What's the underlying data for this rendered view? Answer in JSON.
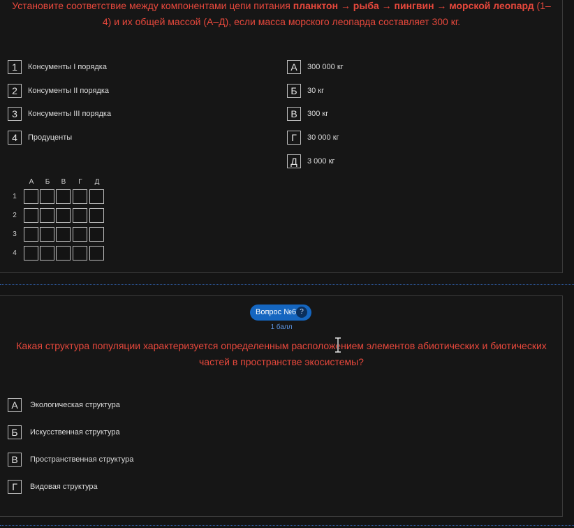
{
  "q5": {
    "title_parts": [
      {
        "t": "Установите соответствие между компонентами цепи питания ",
        "b": false
      },
      {
        "t": "планктон → рыба → пингвин → морской леопард",
        "b": true
      },
      {
        "t": " (1–4) и их общей массой (А–Д), если масса морского леопарда составляет 300 кг.",
        "b": false
      }
    ],
    "left_items": [
      {
        "key": "1",
        "label": "Консументы I порядка"
      },
      {
        "key": "2",
        "label": "Консументы II порядка"
      },
      {
        "key": "3",
        "label": "Консументы III порядка"
      },
      {
        "key": "4",
        "label": "Продуценты"
      }
    ],
    "right_items": [
      {
        "key": "А",
        "label": "300 000 кг"
      },
      {
        "key": "Б",
        "label": "30 кг"
      },
      {
        "key": "В",
        "label": "300 кг"
      },
      {
        "key": "Г",
        "label": "30 000 кг"
      },
      {
        "key": "Д",
        "label": "3 000 кг"
      }
    ],
    "grid_columns": [
      "А",
      "Б",
      "В",
      "Г",
      "Д"
    ],
    "grid_rows": [
      "1",
      "2",
      "3",
      "4"
    ]
  },
  "q6": {
    "badge": "Вопрос №6",
    "help": "?",
    "score": "1 балл",
    "title": "Какая структура популяции характеризуется определенным расположением элементов абиотических и биотических частей в пространстве экосистемы?",
    "options": [
      {
        "key": "А",
        "label": "Экологическая структура"
      },
      {
        "key": "Б",
        "label": "Искусственная структура"
      },
      {
        "key": "В",
        "label": "Пространственная структура"
      },
      {
        "key": "Г",
        "label": "Видовая структура"
      }
    ]
  },
  "colors": {
    "accent": "#1566c0",
    "question_text": "#e8483c"
  }
}
